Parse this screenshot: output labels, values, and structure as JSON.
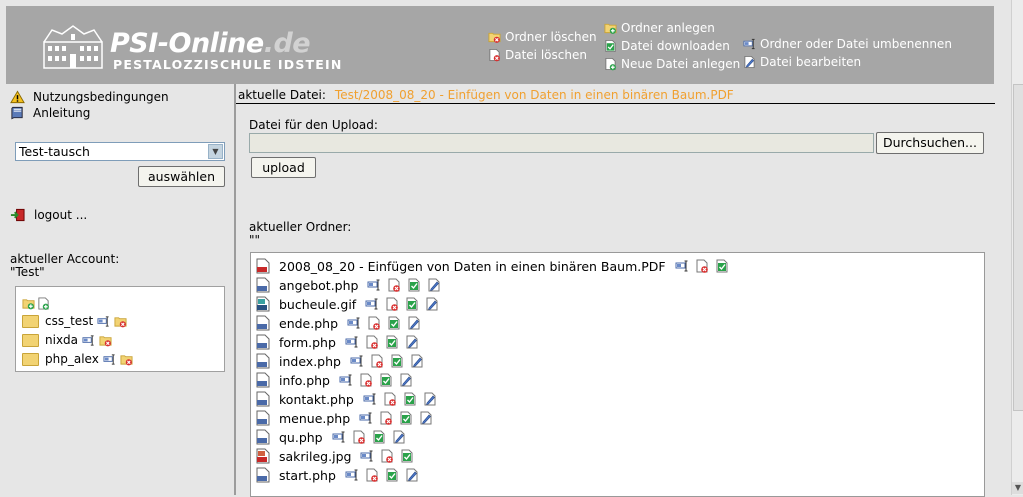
{
  "brand": {
    "name": "PSI-Online",
    "tld": ".de",
    "subtitle": "PESTALOZZISCHULE IDSTEIN"
  },
  "header_actions": [
    {
      "label": "Ordner löschen",
      "icon": "delete-folder-icon"
    },
    {
      "label": "Datei löschen",
      "icon": "delete-file-icon"
    },
    {
      "label": "Ordner anlegen",
      "icon": "new-folder-icon"
    },
    {
      "label": "Datei downloaden",
      "icon": "download-icon"
    },
    {
      "label": "Neue Datei anlegen",
      "icon": "new-file-icon"
    },
    {
      "label": "Ordner oder Datei umbenennen",
      "icon": "rename-icon"
    },
    {
      "label": "Datei bearbeiten",
      "icon": "edit-icon"
    }
  ],
  "sidebar": {
    "terms_link": "Nutzungsbedingungen",
    "manual_link": "Anleitung",
    "account_select_value": "Test-tausch",
    "select_button": "auswählen",
    "logout": "logout ...",
    "account_label": "aktueller Account:",
    "account_name": "\"Test\"",
    "folders": [
      "css_test",
      "nixda",
      "php_alex"
    ]
  },
  "main": {
    "current_file_label": "aktuelle Datei:",
    "current_file": "Test/2008_08_20 - Einfügen von Daten in einen binären Baum.PDF",
    "upload_label": "Datei für den Upload:",
    "browse_button": "Durchsuchen...",
    "upload_button": "upload",
    "folder_label": "aktueller Ordner:",
    "folder_value": "\"\"",
    "files": [
      {
        "name": "2008_08_20 - Einfügen von Daten in einen binären Baum.PDF",
        "type": "pdf",
        "editable": false
      },
      {
        "name": "angebot.php",
        "type": "php",
        "editable": true
      },
      {
        "name": "bucheule.gif",
        "type": "gif",
        "editable": true
      },
      {
        "name": "ende.php",
        "type": "php",
        "editable": true
      },
      {
        "name": "form.php",
        "type": "php",
        "editable": true
      },
      {
        "name": "index.php",
        "type": "php",
        "editable": true
      },
      {
        "name": "info.php",
        "type": "php",
        "editable": true
      },
      {
        "name": "kontakt.php",
        "type": "php",
        "editable": true
      },
      {
        "name": "menue.php",
        "type": "php",
        "editable": true
      },
      {
        "name": "qu.php",
        "type": "php",
        "editable": true
      },
      {
        "name": "sakrileg.jpg",
        "type": "jpg",
        "editable": false
      },
      {
        "name": "start.php",
        "type": "php",
        "editable": true
      }
    ]
  },
  "colors": {
    "header_bg": "#a6a6a6",
    "page_bg": "#e6e6e6",
    "path_accent": "#f0a030"
  }
}
